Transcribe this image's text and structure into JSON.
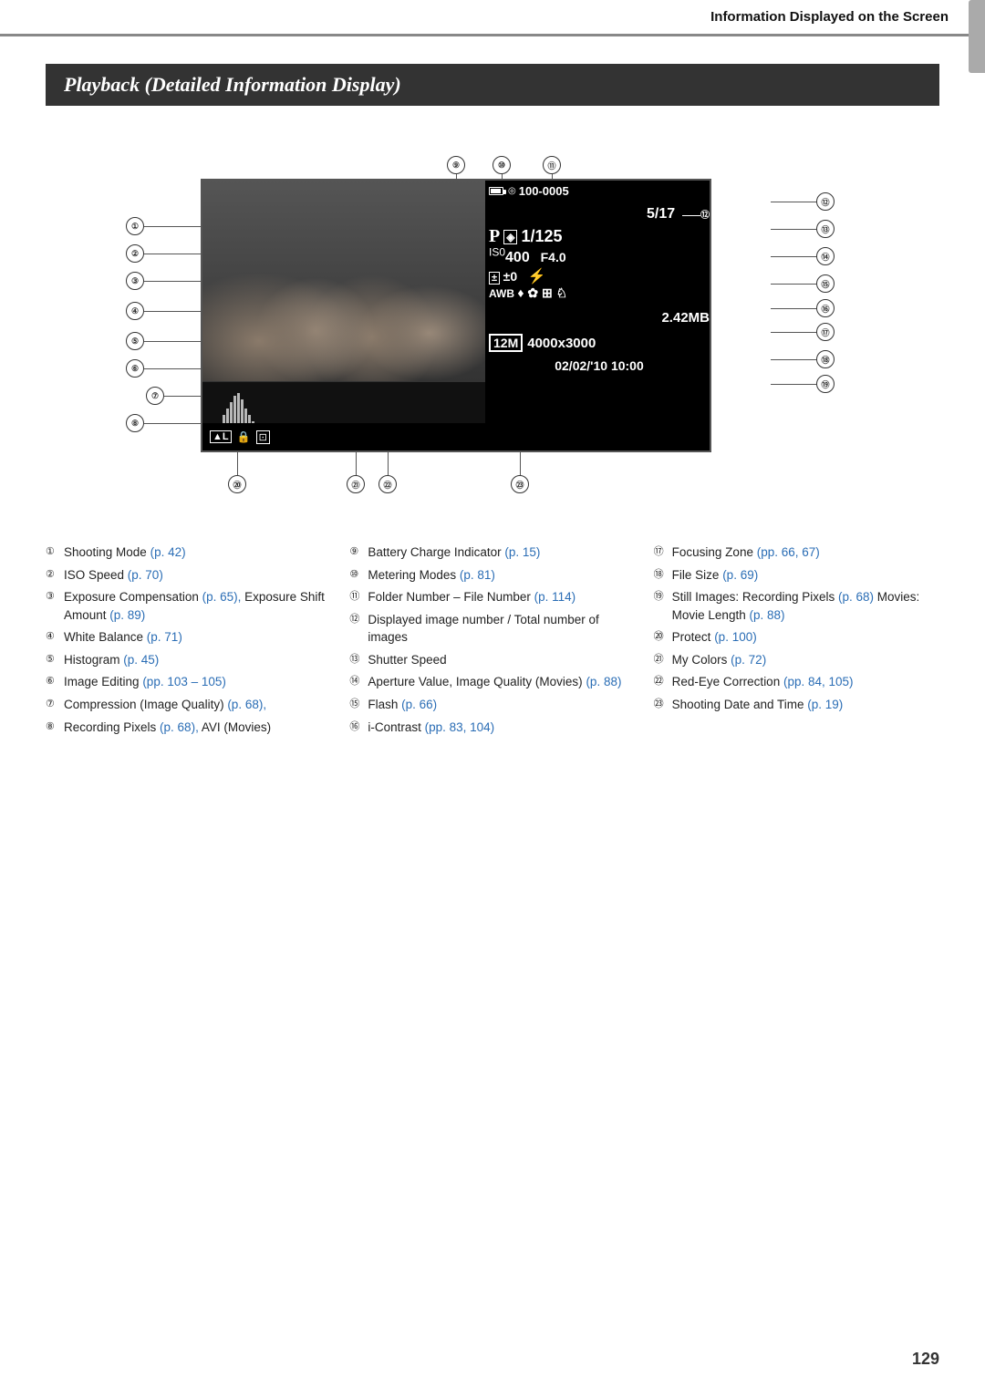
{
  "header": {
    "title": "Information Displayed on the Screen"
  },
  "section": {
    "heading": "Playback (Detailed Information Display)"
  },
  "screen": {
    "folder": "100-0005",
    "image_count": "5/17",
    "mode": "P",
    "shutter": "1/125",
    "iso": "ISO400",
    "aperture": "F4.0",
    "exposure_comp": "±0",
    "file_size": "2.42MB",
    "resolution_label": "12M",
    "resolution": "4000x3000",
    "datetime": "02/02/'10  10:00"
  },
  "legend": {
    "col1": [
      {
        "num": "①",
        "text": "Shooting Mode",
        "link": "(p. 42)"
      },
      {
        "num": "②",
        "text": "ISO Speed",
        "link": "(p. 70)"
      },
      {
        "num": "③",
        "text": "Exposure Compensation",
        "link": "(p. 65),",
        "extra": " Exposure Shift Amount",
        "link2": "(p. 89)"
      },
      {
        "num": "④",
        "text": "White Balance",
        "link": "(p. 71)"
      },
      {
        "num": "⑤",
        "text": "Histogram",
        "link": "(p. 45)"
      },
      {
        "num": "⑥",
        "text": "Image Editing",
        "link": "(pp. 103 – 105)"
      },
      {
        "num": "⑦",
        "text": "Compression (Image Quality)",
        "link": "(p. 68),"
      },
      {
        "num": "⑧",
        "text": "Recording Pixels",
        "link": "(p. 68),",
        "extra": " AVI (Movies)"
      }
    ],
    "col2": [
      {
        "num": "⑨",
        "text": "Battery Charge Indicator",
        "link": "(p. 15)"
      },
      {
        "num": "⑩",
        "text": "Metering Modes",
        "link": "(p. 81)"
      },
      {
        "num": "⑪",
        "text": "Folder Number – File Number",
        "link": "(p. 114)"
      },
      {
        "num": "⑫",
        "text": "Displayed image number / Total number of images"
      },
      {
        "num": "⑬",
        "text": "Shutter Speed"
      },
      {
        "num": "⑭",
        "text": "Aperture Value, Image Quality (Movies)",
        "link": "(p. 88)"
      },
      {
        "num": "⑮",
        "text": "Flash",
        "link": "(p. 66)"
      },
      {
        "num": "⑯",
        "text": "i-Contrast",
        "link": "(pp. 83, 104)"
      }
    ],
    "col3": [
      {
        "num": "⑰",
        "text": "Focusing Zone",
        "link": "(pp. 66, 67)"
      },
      {
        "num": "⑱",
        "text": "File Size",
        "link": "(p. 69)"
      },
      {
        "num": "⑲",
        "text": "Still Images: Recording Pixels",
        "link": "(p. 68)",
        "extra": " Movies: Movie Length",
        "link2": "(p. 88)"
      },
      {
        "num": "⑳",
        "text": "Protect",
        "link": "(p. 100)"
      },
      {
        "num": "㉑",
        "text": "My Colors",
        "link": "(p. 72)"
      },
      {
        "num": "㉒",
        "text": "Red-Eye Correction",
        "link": "(pp. 84, 105)"
      },
      {
        "num": "㉓",
        "text": "Shooting Date and Time",
        "link": "(p. 19)"
      }
    ]
  },
  "page_number": "129"
}
